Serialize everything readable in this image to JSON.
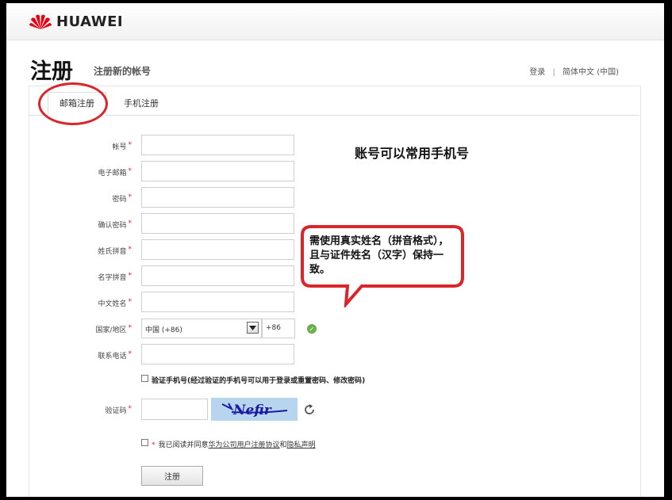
{
  "brand": {
    "name": "HUAWEI"
  },
  "page": {
    "title": "注册",
    "subtitle": "注册新的帐号"
  },
  "top_links": {
    "login": "登录",
    "separator": "|",
    "language": "简体中文 (中国)"
  },
  "tabs": [
    {
      "label": "邮箱注册",
      "active": true
    },
    {
      "label": "手机注册",
      "active": false
    }
  ],
  "form": {
    "fields": [
      {
        "label": "帐号",
        "value": ""
      },
      {
        "label": "电子邮箱",
        "value": ""
      },
      {
        "label": "密码",
        "value": ""
      },
      {
        "label": "确认密码",
        "value": ""
      },
      {
        "label": "姓氏拼音",
        "value": ""
      },
      {
        "label": "名字拼音",
        "value": ""
      },
      {
        "label": "中文姓名",
        "value": ""
      }
    ],
    "country_label": "国家/地区",
    "country_value": "中国 (+86)",
    "country_code": "+86",
    "phone_label": "联系电话",
    "verify_phone_text": "验证手机号(经过验证的手机号可以用于登录或重置密码、修改密码)",
    "captcha_label": "验证码",
    "captcha_text": "Nefir",
    "agree_prefix": "我已阅读并同意",
    "agree_link1": "华为公司用户注册协议",
    "agree_and": "和",
    "agree_link2": "隐私声明",
    "submit_label": "注册",
    "required_mark": "*"
  },
  "annotations": {
    "account_note": "账号可以常用手机号",
    "name_note": "需使用真实姓名（拼音格式），且与证件姓名（汉字）保持一致。"
  },
  "colors": {
    "required": "#d9262c",
    "annotation": "#d9262c",
    "brand": "#e60012",
    "success": "#6ab04c"
  }
}
